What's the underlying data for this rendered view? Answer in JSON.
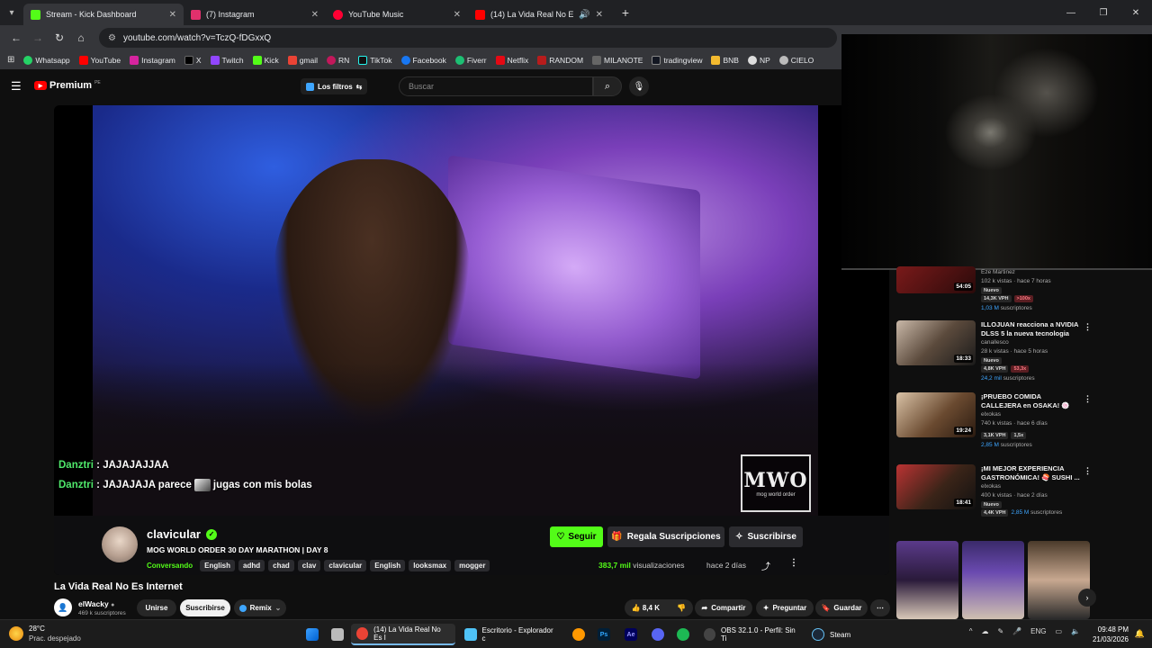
{
  "browser": {
    "tabs": [
      {
        "title": "Stream - Kick Dashboard",
        "color": "#53fc18",
        "active": true
      },
      {
        "title": "(7) Instagram",
        "color": "#e1306c",
        "active": false
      },
      {
        "title": "YouTube Music",
        "color": "#ff0033",
        "active": false
      },
      {
        "title": "(14) La Vida Real No Es Inte",
        "color": "#ff0000",
        "active": false
      }
    ],
    "url": "youtube.com/watch?v=TczQ-fDGxxQ",
    "bookmarks": [
      "Whatsapp",
      "YouTube",
      "Instagram",
      "X",
      "Twitch",
      "Kick",
      "gmail",
      "RN",
      "TikTok",
      "Facebook",
      "Fiverr",
      "Netflix",
      "RANDOM",
      "MILANOTE",
      "tradingview",
      "BNB",
      "NP",
      "CIELO"
    ]
  },
  "youtube": {
    "logo": "Premium",
    "logo_sup": "PE",
    "filters_label": "Los filtros",
    "search_placeholder": "Buscar"
  },
  "player": {
    "chat": [
      {
        "user": "Danztri",
        "message": "JAJAJAJJAA"
      },
      {
        "user": "Danztri",
        "message_before": "JAJAJAJA parece",
        "message_after": "jugas con mis bolas"
      }
    ],
    "watermark_big": "MWO",
    "watermark_small": "mog world order",
    "channel": "clavicular",
    "stream_title": "MOG WORLD ORDER 30 DAY MARATHON | DAY 8",
    "category": "Conversando",
    "tags": [
      "English",
      "adhd",
      "chad",
      "clav",
      "clavicular",
      "English",
      "looksmax",
      "mogger"
    ],
    "follow_label": "Seguir",
    "gift_label": "Regala Suscripciones",
    "subscribe_label": "Suscribirse",
    "views_number": "383,7 mil",
    "views_label": "visualizaciones",
    "ago": "hace 2 días"
  },
  "video": {
    "title": "La Vida Real No Es Internet",
    "owner": "elWacky",
    "owner_subs": "469 k suscriptores",
    "join_label": "Unirse",
    "subscribe_label": "Suscribirse",
    "remix_label": "Remix",
    "likes": "8,4 K",
    "share_label": "Compartir",
    "ask_label": "Preguntar",
    "save_label": "Guardar"
  },
  "recommendations": [
    {
      "title": "",
      "channel": "Eze Martinez",
      "meta": "102 k vistas · hace 7 horas",
      "duration": "54:05",
      "badge1": "Nuevo",
      "vph": "14,3K VPH",
      "mult": ">100x",
      "subs": "1,03 M",
      "subs_label": "suscriptores",
      "thumb": "#7a1a1a"
    },
    {
      "title": "ILLOJUAN reacciona a NVIDIA DLSS 5 la nueva tecnologia de...",
      "channel": "canallesco",
      "meta": "28 k vistas · hace 5 horas",
      "duration": "18:33",
      "badge1": "Nuevo",
      "vph": "4,8K VPH",
      "mult": "53,3x",
      "subs": "24,2 mil",
      "subs_label": "suscriptores",
      "thumb": "#5b4a3c"
    },
    {
      "title": "¡PRUEBO COMIDA CALLEJERA en OSAKA! 🍥 Xokas en Japón",
      "channel": "elxokas",
      "meta": "740 k vistas · hace 6 días",
      "duration": "19:24",
      "badge1": "",
      "vph": "3,1K VPH",
      "mult": "1,5x",
      "subs": "2,85 M",
      "subs_label": "suscriptores",
      "thumb": "#6a4a30"
    },
    {
      "title": "¡MI MEJOR EXPERIENCIA GASTRONÓMICA! 🍣 SUSHI ...",
      "channel": "elxokas",
      "meta": "400 k vistas · hace 2 días",
      "duration": "18:41",
      "badge1": "Nuevo",
      "vph": "4,4K VPH",
      "mult": "",
      "subs": "2,85 M",
      "subs_label": "suscriptores",
      "thumb": "#3a2418"
    }
  ],
  "taskbar": {
    "temp": "28°C",
    "condition": "Prac. despejado",
    "items": [
      {
        "label": "(14) La Vida Real No Es I",
        "color": "#ea4335",
        "active": true
      },
      {
        "label": "Escritorio - Explorador c",
        "color": "#ffb900",
        "active": false
      },
      {
        "label": "OBS 32.1.0 - Perfil: Sin Ti",
        "color": "#444444",
        "active": false
      },
      {
        "label": "Steam",
        "color": "#1b2838",
        "active": false
      }
    ],
    "lang": "ENG",
    "time": "09:48 PM",
    "date": "21/03/2026"
  }
}
